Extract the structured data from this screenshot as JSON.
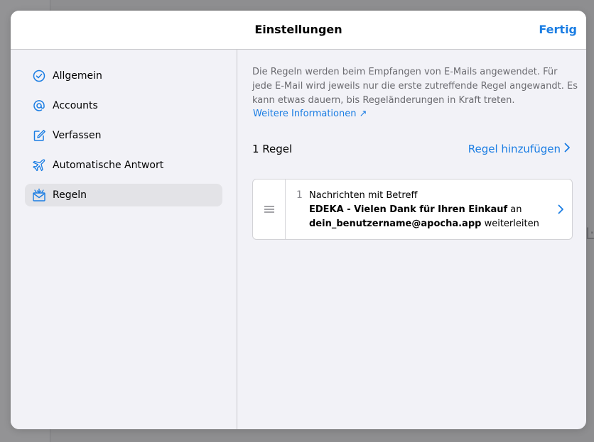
{
  "header": {
    "title": "Einstellungen",
    "done_label": "Fertig"
  },
  "sidebar": {
    "items": [
      {
        "label": "Allgemein",
        "icon": "checkmark-circle-icon"
      },
      {
        "label": "Accounts",
        "icon": "at-sign-icon"
      },
      {
        "label": "Verfassen",
        "icon": "compose-icon"
      },
      {
        "label": "Automatische Antwort",
        "icon": "airplane-icon"
      },
      {
        "label": "Regeln",
        "icon": "envelope-rules-icon",
        "selected": true
      }
    ]
  },
  "rules_page": {
    "info_text": "Die Regeln werden beim Empfangen von E-Mails angewendet. Für jede E-Mail wird jeweils nur die erste zutreffende Regel angewandt. Es kann etwas dauern, bis Regeländerungen in Kraft treten.",
    "more_info_label": "Weitere Informationen ↗",
    "count_label": "1 Regel",
    "add_rule_label": "Regel hinzufügen",
    "rules": [
      {
        "number": "1",
        "line1": "Nachrichten mit Betreff",
        "subject": "EDEKA - Vielen Dank für Ihren Einkauf",
        "connector": "an",
        "recipient": "dein_benutzername@apocha.app",
        "action": "weiterleiten"
      }
    ]
  },
  "background": {
    "fragment_text": "Ŀ"
  },
  "colors": {
    "accent": "#1a7de3",
    "icon": "#1a7de3"
  }
}
